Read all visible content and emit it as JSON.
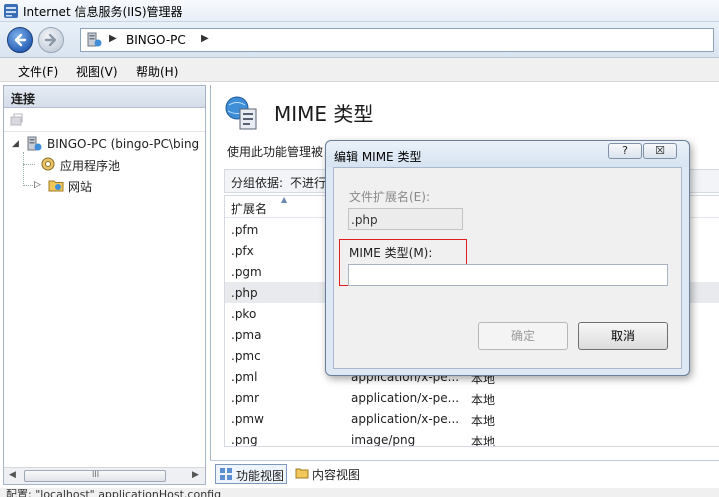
{
  "window": {
    "title": "Internet 信息服务(IIS)管理器"
  },
  "address": {
    "segments": [
      "BINGO-PC"
    ]
  },
  "menu": {
    "items": [
      "文件(F)",
      "视图(V)",
      "帮助(H)"
    ]
  },
  "connections": {
    "title": "连接",
    "tree": [
      {
        "label": "BINGO-PC (bingo-PC\\bing",
        "expander": "◢",
        "icon": "server-icon"
      },
      {
        "label": "应用程序池",
        "icon": "app-pool-icon"
      },
      {
        "label": "网站",
        "expander": "▷",
        "icon": "sites-folder-icon"
      }
    ],
    "hscroll": {
      "left": "◀",
      "grip": "III",
      "right": "▶"
    }
  },
  "feature": {
    "title": "MIME 类型",
    "description": "使用此功能管理被",
    "group_by_label": "分组依据:",
    "group_by_value": "不进行",
    "column_ext": "扩展名",
    "rows": [
      {
        "ext": ".pfm",
        "mime": "",
        "type": ""
      },
      {
        "ext": ".pfx",
        "mime": "",
        "type": ""
      },
      {
        "ext": ".pgm",
        "mime": "",
        "type": ""
      },
      {
        "ext": ".php",
        "mime": "",
        "type": ""
      },
      {
        "ext": ".pko",
        "mime": "",
        "type": ""
      },
      {
        "ext": ".pma",
        "mime": "",
        "type": ""
      },
      {
        "ext": ".pmc",
        "mime": "",
        "type": ""
      },
      {
        "ext": ".pml",
        "mime": "application/x-pe...",
        "type": "本地"
      },
      {
        "ext": ".pmr",
        "mime": "application/x-pe...",
        "type": "本地"
      },
      {
        "ext": ".pmw",
        "mime": "application/x-pe...",
        "type": "本地"
      },
      {
        "ext": ".png",
        "mime": "image/png",
        "type": "本地"
      }
    ],
    "selected_row": ".php"
  },
  "bottom": {
    "features_view": "功能视图",
    "content_view": "内容视图"
  },
  "status": {
    "text": "配置: \"localhost\" applicationHost.config"
  },
  "dialog": {
    "title": "编辑 MIME 类型",
    "help": "?",
    "close": "☒",
    "ext_label": "文件扩展名(E):",
    "ext_value": ".php",
    "mime_label": "MIME 类型(M):",
    "mime_value": "",
    "ok": "确定",
    "cancel": "取消"
  }
}
